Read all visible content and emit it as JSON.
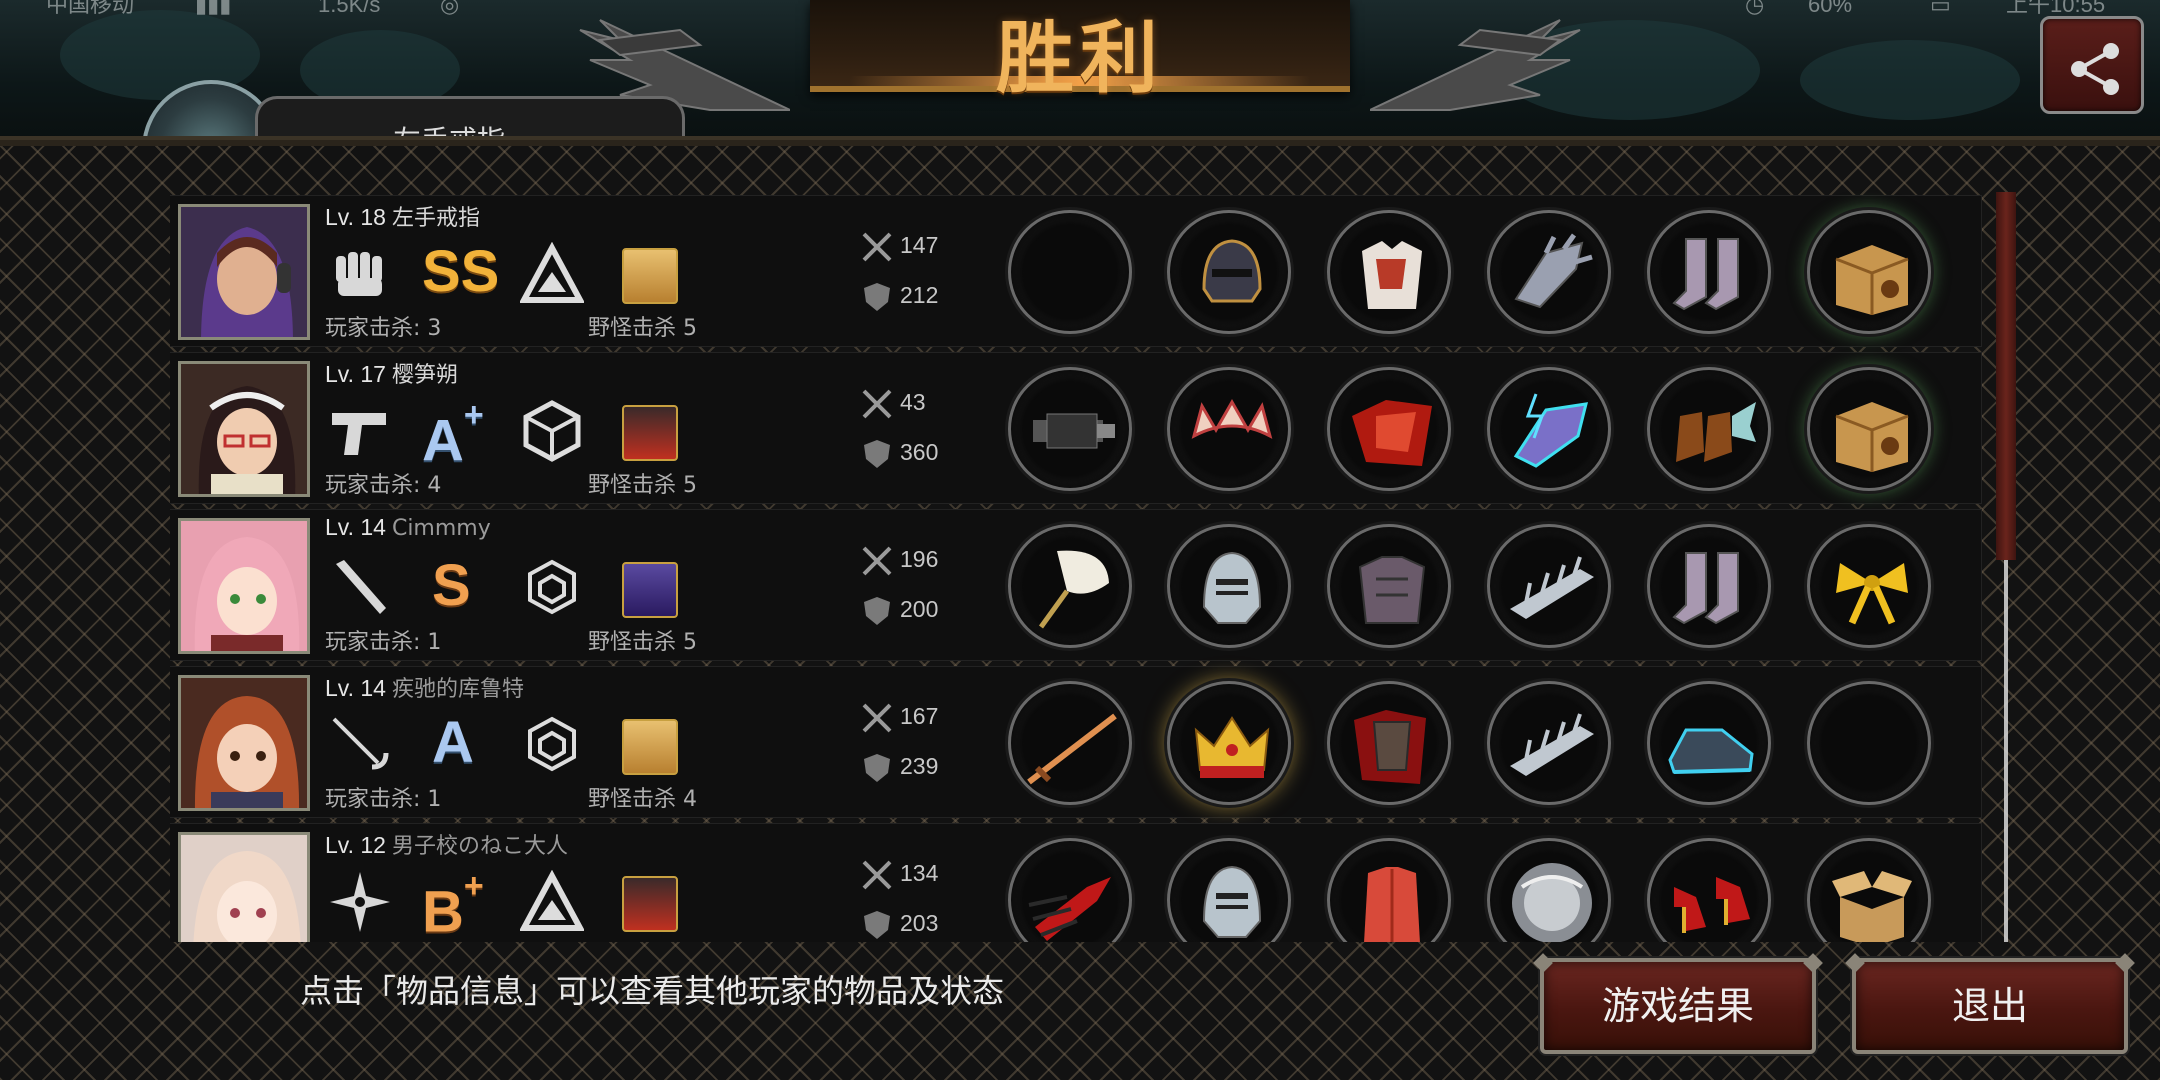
{
  "status_bar": {
    "carrier": "中国移动",
    "net_speed": "1.5K/s",
    "battery": "60%",
    "time": "上午10:55"
  },
  "header": {
    "title": "胜利",
    "share_icon": "share-icon"
  },
  "current_player_tab": {
    "label": "左手戒指"
  },
  "players": [
    {
      "level": "Lv. 18",
      "name": "左手戒指",
      "name_dim": false,
      "weapon_icon": "fist-icon",
      "grade": "SS",
      "grade_color": "gold",
      "mode_icon": "triangle-icon",
      "monster_icon": "monster-yellow-icon",
      "player_kills": "玩家击杀: 3",
      "monster_kills": "野怪击杀 5",
      "attack": "147",
      "defense": "212",
      "items": [
        "empty",
        "helmet-icon",
        "armor-icon",
        "gauntlet-icon",
        "boots-icon",
        "cat-box-icon"
      ]
    },
    {
      "level": "Lv. 17",
      "name": "樱笋朔",
      "name_dim": false,
      "weapon_icon": "pistol-icon",
      "grade": "A+",
      "grade_color": "blue",
      "mode_icon": "cube-icon",
      "monster_icon": "monster-goggles-icon",
      "player_kills": "玩家击杀: 4",
      "monster_kills": "野怪击杀 5",
      "attack": "43",
      "defense": "360",
      "items": [
        "gatling-icon",
        "tiara-icon",
        "red-armor-icon",
        "lightning-gauntlet-icon",
        "winged-boots-icon",
        "cat-box-icon"
      ]
    },
    {
      "level": "Lv. 14",
      "name": "Cimmmy",
      "name_dim": true,
      "weapon_icon": "bat-icon",
      "grade": "S",
      "grade_color": "orange",
      "mode_icon": "hexagon-icon",
      "monster_icon": "monster-purple-icon",
      "player_kills": "玩家击杀: 1",
      "monster_kills": "野怪击杀 5",
      "attack": "196",
      "defense": "200",
      "items": [
        "fan-icon",
        "knight-helmet-icon",
        "plate-armor-icon",
        "spiked-bracer-icon",
        "boots-icon",
        "ribbon-icon"
      ]
    },
    {
      "level": "Lv. 14",
      "name": "疾驰的库鲁特",
      "name_dim": true,
      "weapon_icon": "rapier-icon",
      "grade": "A",
      "grade_color": "blue",
      "mode_icon": "hexagon-icon",
      "monster_icon": "monster-yellow-icon",
      "player_kills": "玩家击杀: 1",
      "monster_kills": "野怪击杀 4",
      "attack": "167",
      "defense": "239",
      "items": [
        "sword-icon",
        "crown-icon",
        "caped-armor-icon",
        "spiked-bracer-icon",
        "sneaker-icon",
        "empty"
      ]
    },
    {
      "level": "Lv. 12",
      "name": "男子校のねこ大人",
      "name_dim": true,
      "weapon_icon": "shuriken-icon",
      "grade": "B+",
      "grade_color": "orange",
      "mode_icon": "triangle-icon",
      "monster_icon": "monster-goggles-icon",
      "player_kills": "",
      "monster_kills": "",
      "attack": "134",
      "defense": "203",
      "items": [
        "claw-icon",
        "knight-helmet-icon",
        "red-suit-icon",
        "steel-disc-icon",
        "heels-icon",
        "open-box-icon"
      ]
    }
  ],
  "footer": {
    "hint": "点击「物品信息」可以查看其他玩家的物品及状态",
    "result_button": "游戏结果",
    "exit_button": "退出"
  }
}
